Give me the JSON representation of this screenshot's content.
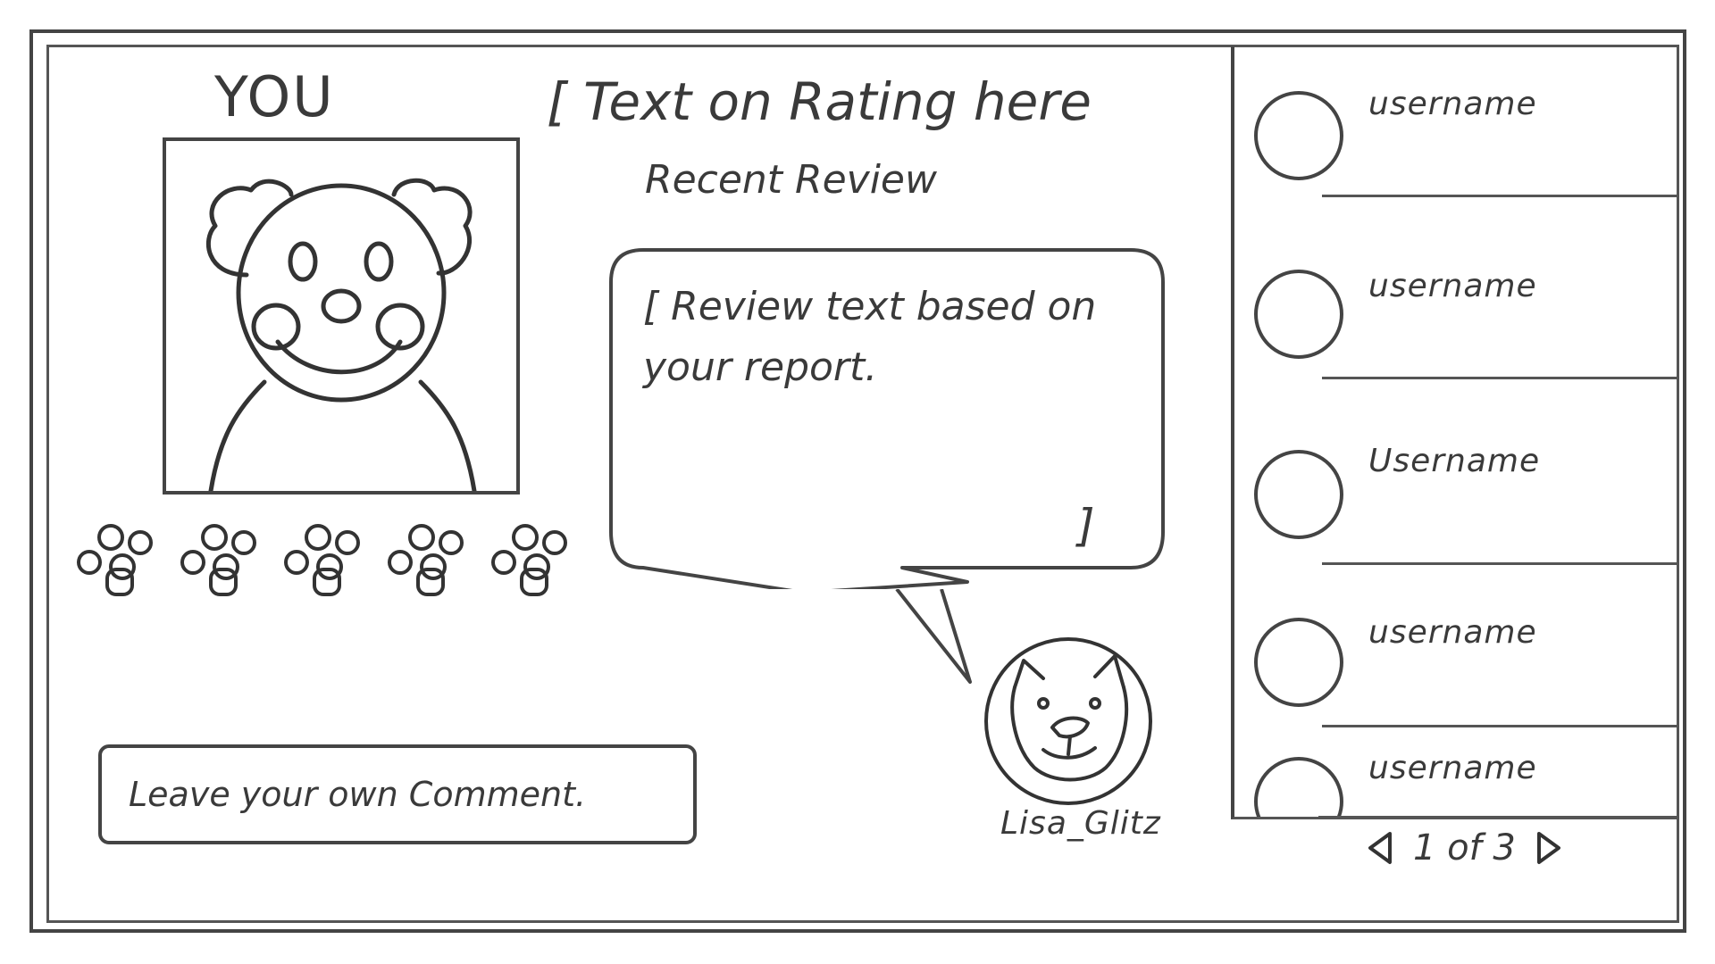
{
  "profile": {
    "you_label": "YOU"
  },
  "main": {
    "rating_heading": "[ Text on Rating here",
    "recent_heading": "Recent Review",
    "review_text": "[ Review text based on your report.",
    "review_close_bracket": "]",
    "reviewer_name": "Lisa_Glitz"
  },
  "comment": {
    "placeholder": "Leave your own Comment."
  },
  "sidebar": {
    "users": [
      {
        "name": "username"
      },
      {
        "name": "username"
      },
      {
        "name": "Username"
      },
      {
        "name": "username"
      },
      {
        "name": "username"
      }
    ]
  },
  "pagination": {
    "label": "1 of 3"
  }
}
